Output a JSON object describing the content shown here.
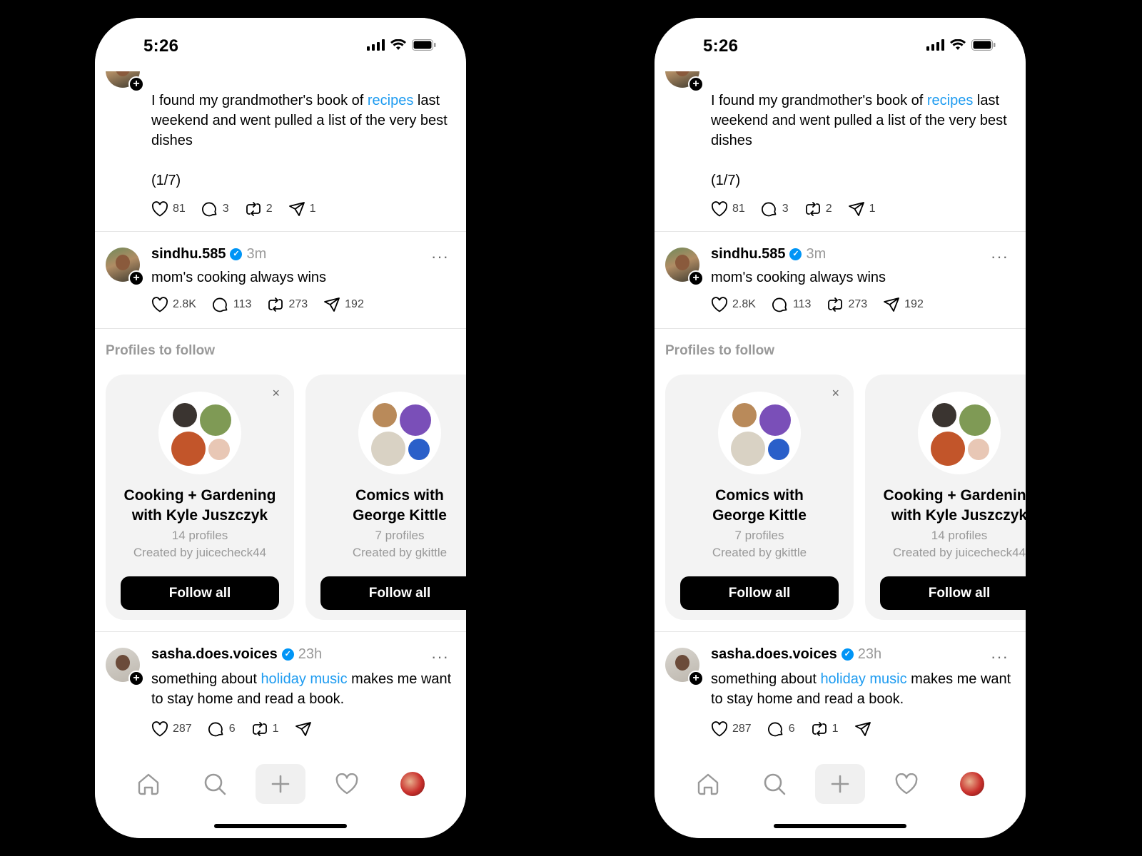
{
  "status": {
    "time": "5:26"
  },
  "post1": {
    "text_before": "I found my grandmother's book of ",
    "link": "recipes",
    "text_after": " last weekend and went pulled a list of the very best dishes",
    "counter": "(1/7)",
    "likes": "81",
    "replies": "3",
    "reposts": "2",
    "shares": "1"
  },
  "post2": {
    "username": "sindhu.585",
    "time": "3m",
    "text": "mom's cooking always wins",
    "likes": "2.8K",
    "replies": "113",
    "reposts": "273",
    "shares": "192",
    "more": "···"
  },
  "profiles_to_follow": {
    "title": "Profiles to follow",
    "cooking": {
      "title_line1": "Cooking + Gardening",
      "title_line2": "with Kyle Juszczyk",
      "count": "14 profiles",
      "creator": "Created by juicecheck44",
      "button": "Follow all",
      "close": "×"
    },
    "comics": {
      "title_line1": "Comics with",
      "title_line2": "George Kittle",
      "count": "7 profiles",
      "creator": "Created by gkittle",
      "button": "Follow all",
      "close": "×"
    }
  },
  "post3": {
    "username": "sasha.does.voices",
    "time": "23h",
    "text_before": "something about ",
    "link": "holiday music",
    "text_after": " makes me want to stay home and read a book.",
    "likes": "287",
    "replies": "6",
    "reposts": "1",
    "more": "···"
  },
  "badge_plus": "+",
  "verified_mark": "✓",
  "colors": {
    "link": "#1d9bf0",
    "verified": "#0095f6",
    "button": "#000000"
  },
  "icons": [
    "heart-icon",
    "reply-icon",
    "repost-icon",
    "share-icon",
    "home-icon",
    "search-icon",
    "plus-icon",
    "activity-heart-icon",
    "profile-avatar"
  ]
}
